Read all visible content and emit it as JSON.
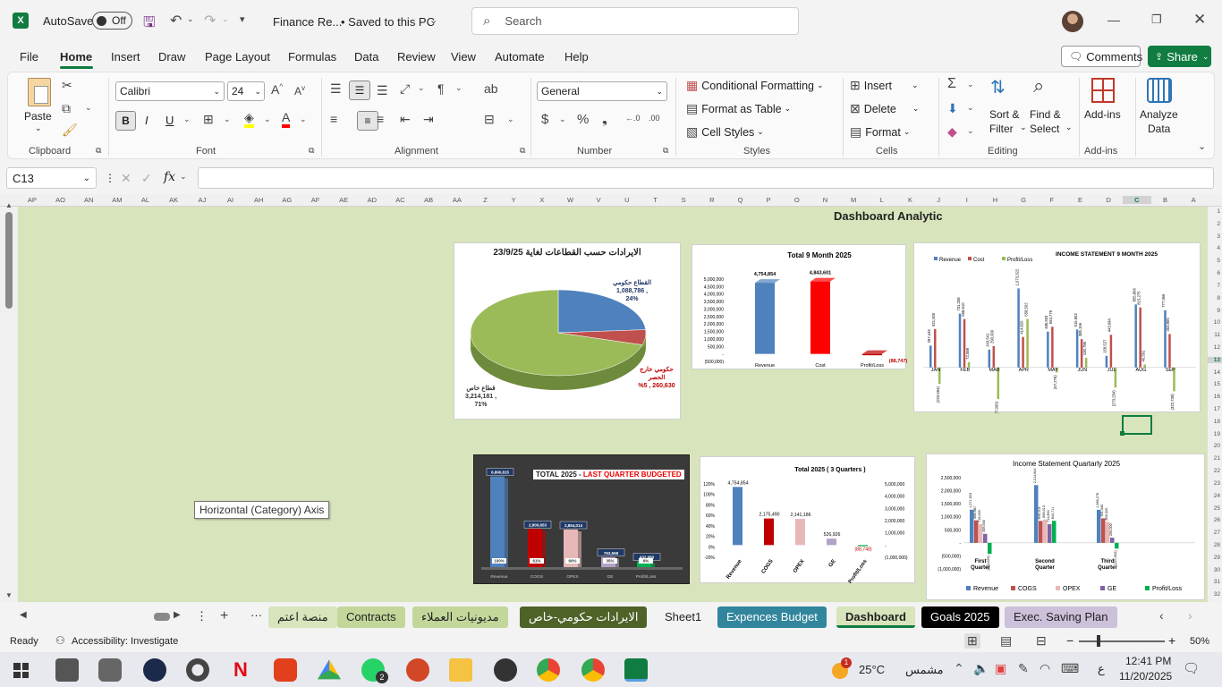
{
  "titlebar": {
    "autosave_label": "AutoSave",
    "autosave_state": "Off",
    "file_title": "Finance Re...",
    "save_status": "• Saved to this PC",
    "search_placeholder": "Search"
  },
  "menu": [
    "File",
    "Home",
    "Insert",
    "Draw",
    "Page Layout",
    "Formulas",
    "Data",
    "Review",
    "View",
    "Automate",
    "Help"
  ],
  "menu_active": "Home",
  "comments_label": "Comments",
  "share_label": "Share",
  "ribbon": {
    "paste": "Paste",
    "clipboard": "Clipboard",
    "font_name": "Calibri",
    "font_size": "24",
    "font": "Font",
    "bold": "B",
    "italic": "I",
    "underline": "U",
    "alignment": "Alignment",
    "number_format": "General",
    "number": "Number",
    "cond_format": "Conditional Formatting",
    "format_table": "Format as Table",
    "cell_styles": "Cell Styles",
    "styles": "Styles",
    "insert": "Insert",
    "delete": "Delete",
    "format": "Format",
    "cells": "Cells",
    "sort_filter_1": "Sort &",
    "sort_filter_2": "Filter",
    "find_select_1": "Find &",
    "find_select_2": "Select",
    "editing": "Editing",
    "addins": "Add-ins",
    "addins_group": "Add-ins",
    "analyze_1": "Analyze",
    "analyze_2": "Data"
  },
  "formula": {
    "name_box": "C13",
    "fx": "fx",
    "value": ""
  },
  "columns": [
    "AP",
    "AO",
    "AN",
    "AM",
    "AL",
    "AK",
    "AJ",
    "AI",
    "AH",
    "AG",
    "AF",
    "AE",
    "AD",
    "AC",
    "AB",
    "AA",
    "Z",
    "Y",
    "X",
    "W",
    "V",
    "U",
    "T",
    "S",
    "R",
    "Q",
    "P",
    "O",
    "N",
    "M",
    "L",
    "K",
    "J",
    "I",
    "H",
    "G",
    "F",
    "E",
    "D",
    "C",
    "B",
    "A"
  ],
  "rows": [
    "1",
    "2",
    "3",
    "4",
    "5",
    "6",
    "7",
    "8",
    "9",
    "10",
    "11",
    "12",
    "13",
    "14",
    "15",
    "16",
    "17",
    "18",
    "19",
    "20",
    "21",
    "22",
    "23",
    "24",
    "25",
    "26",
    "27",
    "28",
    "29",
    "30",
    "31",
    "32"
  ],
  "dashboard_title": "Dashboard Analytic",
  "tooltip": "Horizontal (Category) Axis",
  "charts": {
    "pie": {
      "title": "الايرادات حسب القطاعات لغاية 23/9/25",
      "labels": [
        {
          "text": "القطاع حكومي",
          "value": "1,088,786 ,",
          "pct": "24%"
        },
        {
          "text": "حكومي خارج الحصر",
          "value": "%5 , 260,630",
          "pct": ""
        },
        {
          "text": "قطاع خاص",
          "value": "3,214,181 ,",
          "pct": "71%"
        }
      ],
      "chart_data": {
        "type": "pie",
        "categories": [
          "القطاع حكومي",
          "حكومي خارج الحصر",
          "قطاع خاص"
        ],
        "values": [
          1088786,
          260630,
          3214181
        ],
        "colors": [
          "#4f81bd",
          "#c0504d",
          "#9bbb59"
        ]
      }
    },
    "total9": {
      "title": "Total 9 Month 2025",
      "chart_data": {
        "type": "bar",
        "categories": [
          "Revenue",
          "Cost",
          "Profit/Loss"
        ],
        "values": [
          4754854,
          4843601,
          -88747
        ],
        "value_labels": [
          "4,754,854",
          "4,843,601",
          "(88,747)"
        ],
        "yticks": [
          "5,000,000",
          "4,500,000",
          "4,000,000",
          "3,500,000",
          "3,000,000",
          "2,500,000",
          "2,000,000",
          "1,500,000",
          "1,000,000",
          "500,000",
          "-",
          "(500,000)"
        ],
        "ylim": [
          -500000,
          5000000
        ],
        "colors": [
          "#4f81bd",
          "#ff0000",
          "#c00000"
        ]
      }
    },
    "income9": {
      "title": "INCOME STATEMENT 9 MONTH 2025",
      "legend": [
        "Revenue",
        "Cost",
        "Profit/Loss"
      ],
      "chart_data": {
        "type": "bar",
        "categories": [
          "JAN",
          "FEB",
          "MAR",
          "APR",
          "MAY",
          "JUN",
          "JUL",
          "AUG",
          "SEP"
        ],
        "series": [
          {
            "name": "Revenue",
            "values": [
              297446,
              731208,
              243541,
              1073322,
              486503,
              515952,
              158527,
              855866,
              777366
            ],
            "color": "#4f81bd"
          },
          {
            "name": "Cost",
            "values": [
              521000,
              658610,
              290000,
              414820,
              553779,
              385156,
              443694,
              815275,
              453905
            ],
            "color": "#c0504d"
          },
          {
            "name": "Profit/Loss",
            "values": [
              -223554,
              72598,
              -427000,
              658502,
              -67276,
              130796,
              -273254,
              40591,
              -322739
            ],
            "color": "#9bbb59"
          }
        ],
        "ylim": [
          -500000,
          1200000
        ]
      }
    },
    "lastq": {
      "title_a": "TOTAL 2025 - ",
      "title_b": "LAST QUARTER BUDGETED",
      "chart_data": {
        "type": "bar",
        "categories": [
          "Revenue",
          "COGS",
          "OPEX",
          "GE",
          "Profit/Loss"
        ],
        "values": [
          6890815,
          2900653,
          2854014,
          763568,
          432680
        ],
        "value_labels": [
          "6,890,815",
          "2,900,653",
          "2,854,014",
          "763,568",
          "432,680"
        ],
        "pct_labels": [
          "100%",
          "61%",
          "60%",
          "35%",
          "6%"
        ],
        "colors": [
          "#4f81bd",
          "#c00000",
          "#e6b9b8",
          "#b3a2c7",
          "#00b050"
        ],
        "ylim": [
          0,
          7000000
        ]
      }
    },
    "total2025": {
      "title": "Total 2025 ( 3 Quarters )",
      "chart_data": {
        "type": "bar",
        "categories": [
          "Revenue",
          "COGS",
          "OPEX",
          "GE",
          "Profit/Loss"
        ],
        "values": [
          4754854,
          2175490,
          2141186,
          526926,
          -88748
        ],
        "value_labels": [
          "4,754,854",
          "2,175,490",
          "2,141,186",
          "526,926",
          "(88,748)"
        ],
        "yticks_left": [
          "120%",
          "100%",
          "80%",
          "60%",
          "40%",
          "20%",
          "0%",
          "-20%"
        ],
        "yticks_right": [
          "5,000,000",
          "4,000,000",
          "3,000,000",
          "2,000,000",
          "1,000,000",
          "-",
          "(1,000,000)"
        ],
        "colors": [
          "#4f81bd",
          "#c00000",
          "#e6b9b8",
          "#b3a2c7",
          "#00b050"
        ],
        "ylim": [
          -1000000,
          5000000
        ]
      }
    },
    "quarterly": {
      "title": "Income Statement Quartarly 2025",
      "legend": [
        "Revenue",
        "COGS",
        "OPEX",
        "GE",
        "Profit/Loss"
      ],
      "chart_data": {
        "type": "bar",
        "categories": [
          "First Quarter",
          "Second Quarter",
          "Third Quarter"
        ],
        "series": [
          {
            "name": "Revenue",
            "values": [
              1271923,
              2214844,
              1268278
            ],
            "color": "#4f81bd"
          },
          {
            "name": "COGS",
            "values": [
              865587,
              840113,
              941000
            ],
            "color": "#c0504d"
          },
          {
            "name": "OPEX",
            "values": [
              716000,
              896013,
              800320
            ],
            "color": "#e6b9b8"
          },
          {
            "name": "GE",
            "values": [
              345000,
              714894,
              200000
            ],
            "color": "#8064a2"
          },
          {
            "name": "Profit/Loss",
            "values": [
              -424025,
              844711,
              -221502
            ],
            "color": "#00b050"
          }
        ],
        "yticks": [
          "2,500,000",
          "2,000,000",
          "1,500,000",
          "1,000,000",
          "500,000",
          "-",
          "(500,000)",
          "(1,000,000)"
        ],
        "ylim": [
          -1000000,
          2500000
        ]
      }
    }
  },
  "tabs": [
    {
      "label": "منصة اعتم",
      "bg": "#d8e4bc",
      "color": "#222"
    },
    {
      "label": "Contracts",
      "bg": "#c4d79b",
      "color": "#222"
    },
    {
      "label": "مديونيات العملاء",
      "bg": "#c4d79b",
      "color": "#222"
    },
    {
      "label": "الايرادات حكومي-خاص",
      "bg": "#4f6228",
      "color": "#fff"
    },
    {
      "label": "Sheet1",
      "bg": "transparent",
      "color": "#222"
    },
    {
      "label": "Expences Budget",
      "bg": "#31859c",
      "color": "#fff"
    },
    {
      "label": "Dashboard",
      "bg": "#d8e4bc",
      "color": "#222"
    },
    {
      "label": "Goals 2025",
      "bg": "#000000",
      "color": "#fff"
    },
    {
      "label": "Exec. Saving Plan",
      "bg": "#ccc0da",
      "color": "#222"
    }
  ],
  "status": {
    "ready": "Ready",
    "accessibility": "Accessibility: Investigate",
    "zoom": "50%"
  },
  "taskbar": {
    "weather": "25°C",
    "weather_text": "مشمس",
    "lang": "ع",
    "time": "12:41 PM",
    "date": "11/20/2025",
    "whatsapp_badge": "2",
    "weather_badge": "1"
  }
}
